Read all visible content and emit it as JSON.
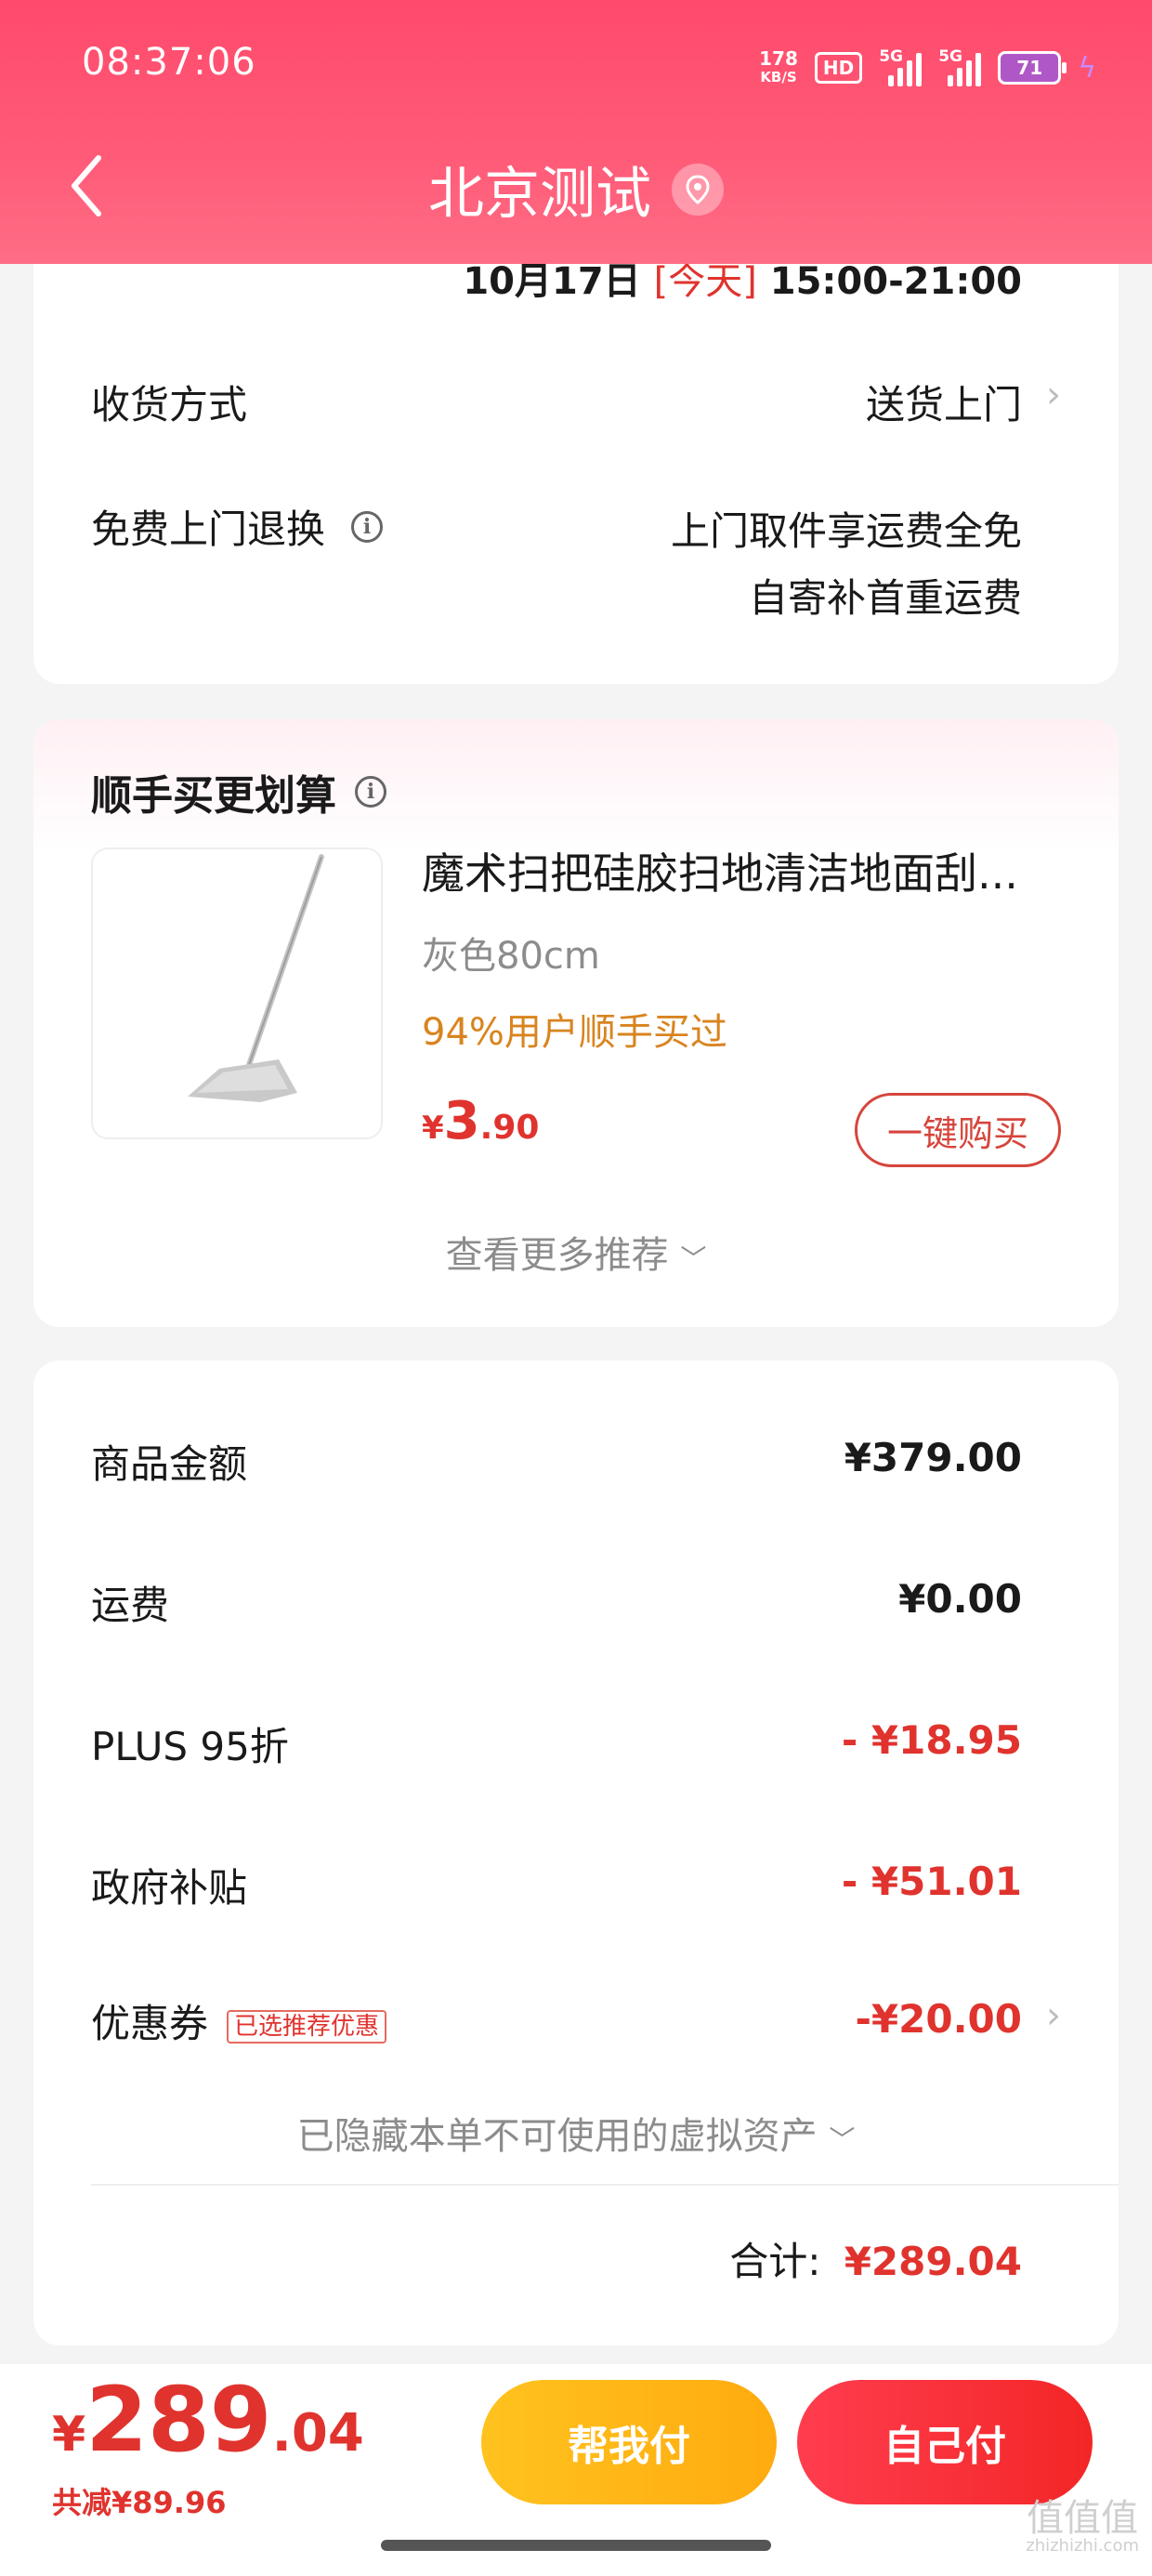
{
  "status_bar": {
    "time": "08:37:06",
    "net_speed_value": "178",
    "net_speed_unit": "KB/S",
    "hd_label": "HD",
    "signal_1": "5G",
    "signal_2": "5G",
    "battery": "71"
  },
  "nav": {
    "title": "北京测试"
  },
  "delivery": {
    "time_date": "10月17日",
    "time_today": "[今天]",
    "time_range": "15:00-21:00",
    "method_label": "收货方式",
    "method_value": "送货上门",
    "return_label": "免费上门退换",
    "return_value_1": "上门取件享运费全免",
    "return_value_2": "自寄补首重运费"
  },
  "recommend": {
    "title": "顺手买更划算",
    "product_name": "魔术扫把硅胶扫地清洁地面刮...",
    "spec": "灰色80cm",
    "hint": "94%用户顺手买过",
    "price_symbol": "¥",
    "price_int": "3",
    "price_dec": ".90",
    "buy_button": "一键购买",
    "more": "查看更多推荐"
  },
  "summary": {
    "rows": [
      {
        "label": "商品金额",
        "value": "¥379.00"
      },
      {
        "label": "运费",
        "value": "¥0.00"
      },
      {
        "label": "PLUS 95折",
        "value": "- ¥18.95"
      },
      {
        "label": "政府补贴",
        "value": "- ¥51.01"
      },
      {
        "label": "优惠券",
        "value": "-¥20.00"
      }
    ],
    "coupon_badge": "已选推荐优惠",
    "hidden_note": "已隐藏本单不可使用的虚拟资产",
    "total_label": "合计:",
    "total_value": "¥289.04"
  },
  "footer": {
    "price_symbol": "¥",
    "price_int": "289",
    "price_dec": ".04",
    "saved": "共减¥89.96",
    "help_pay": "帮我付",
    "self_pay": "自己付"
  },
  "watermark": {
    "main": "值值值",
    "sub": "zhizhizhi.com"
  },
  "colors": {
    "header": "#ff4a6c",
    "price_red": "#e0332e",
    "hint_orange": "#d9841f",
    "help_pay": "#ffb516",
    "self_pay": "#f32626"
  },
  "icons": [
    "back-arrow-icon",
    "location-pin-icon",
    "info-icon",
    "chevron-right-icon",
    "chevron-down-icon",
    "broom-product-image"
  ]
}
